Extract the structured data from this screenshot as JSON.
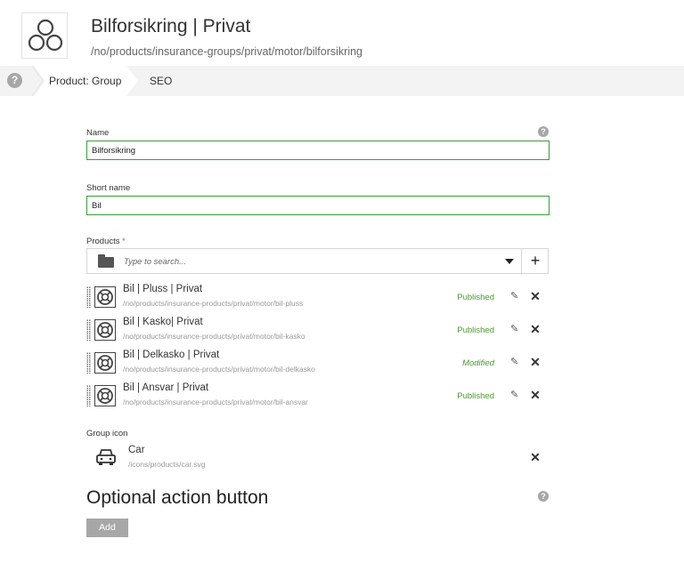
{
  "header": {
    "icon": "three-circles-icon",
    "title": "Bilforsikring | Privat",
    "path": "/no/products/insurance-groups/privat/motor/bilforsikring"
  },
  "tabs": {
    "help": "?",
    "items": [
      {
        "label": "Product: Group",
        "active": true
      },
      {
        "label": "SEO",
        "active": false
      }
    ]
  },
  "form": {
    "name": {
      "label": "Name",
      "value": "Bilforsikring"
    },
    "short_name": {
      "label": "Short name",
      "value": "Bil"
    },
    "products": {
      "label": "Products",
      "required_mark": "*",
      "search_placeholder": "Type to search...",
      "add": "+",
      "items": [
        {
          "title": "Bil | Pluss | Privat",
          "path": "/no/products/insurance-products/privat/motor/bil-pluss",
          "status": "Published",
          "icon": "lifebuoy-icon"
        },
        {
          "title": "Bil | Kasko| Privat",
          "path": "/no/products/insurance-products/privat/motor/bil-kasko",
          "status": "Published",
          "icon": "lifebuoy-icon"
        },
        {
          "title": "Bil | Delkasko | Privat",
          "path": "/no/products/insurance-products/privat/motor/bil-delkasko",
          "status": "Modified",
          "icon": "lifebuoy-icon"
        },
        {
          "title": "Bil | Ansvar | Privat",
          "path": "/no/products/insurance-products/privat/motor/bil-ansvar",
          "status": "Published",
          "icon": "lifebuoy-icon"
        }
      ]
    },
    "group_icon": {
      "label": "Group icon",
      "title": "Car",
      "path": "/icons/products/car.svg",
      "icon": "car-icon"
    },
    "optional_action": {
      "title": "Optional action button",
      "add_label": "Add"
    }
  },
  "colors": {
    "valid_border": "#3a9d3a",
    "published": "#4b9a2f",
    "tabbar": "#f3f3f3",
    "button": "#a7a7a7"
  }
}
